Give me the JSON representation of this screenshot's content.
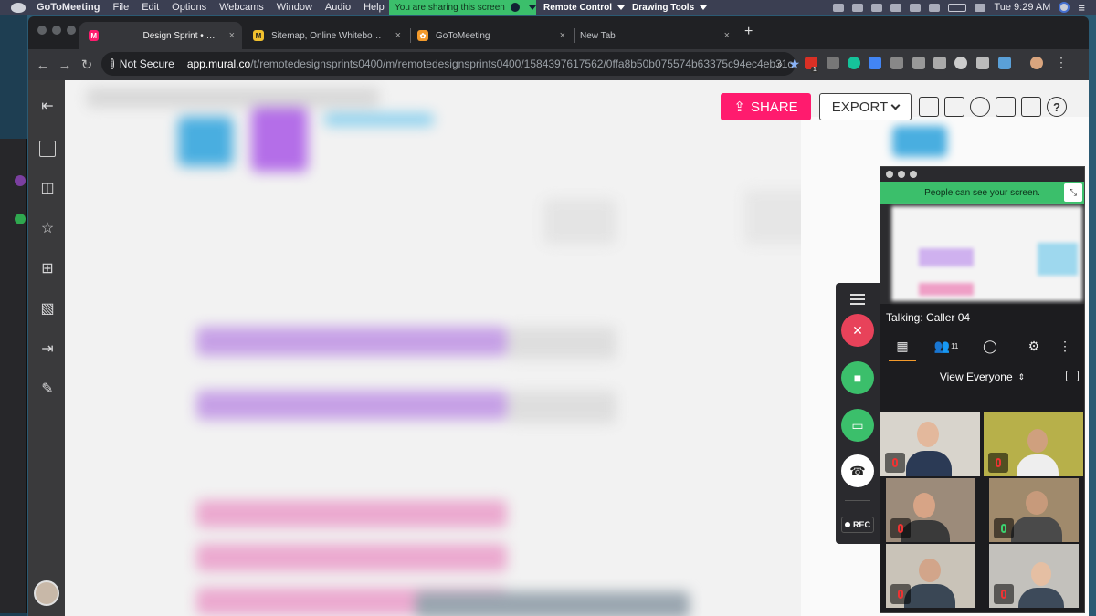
{
  "menubar": {
    "app": "GoToMeeting",
    "items": [
      "File",
      "Edit",
      "Options",
      "Webcams",
      "Window",
      "Audio",
      "Help"
    ],
    "sharing_banner": "You are sharing this screen",
    "remote_control": "Remote Control",
    "drawing_tools": "Drawing Tools",
    "clock": "Tue 9:29 AM"
  },
  "browser": {
    "tabs": [
      {
        "title": "Design Sprint • Remote",
        "favicon": "M",
        "color": "#ff1b6e",
        "active": true
      },
      {
        "title": "Sitemap, Online Whiteboard for Visual Collaboration",
        "favicon": "M",
        "color": "#f2c12e",
        "active": false
      },
      {
        "title": "GoToMeeting",
        "favicon": "✿",
        "color": "#f39a2b",
        "active": false
      },
      {
        "title": "New Tab",
        "favicon": "",
        "color": "",
        "active": false
      }
    ],
    "security": "Not Secure",
    "url_host": "app.mural.co",
    "url_path": "/t/remotedesignsprints0400/m/remotedesignsprints0400/1584397617562/0ffa8b50b075574b63375c94ec4eb31c...",
    "badge_count": "1"
  },
  "mural": {
    "share_label": "SHARE",
    "export_label": "EXPORT",
    "help_label": "?"
  },
  "gotomeeting": {
    "banner": "People can see your screen.",
    "talking": "Talking: Caller 04",
    "attendee_count": "11",
    "view_label": "View Everyone",
    "rec_label": "REC",
    "tiles": [
      {
        "mic": "muted"
      },
      {
        "mic": "muted"
      },
      {
        "mic": "muted"
      },
      {
        "mic": "active"
      },
      {
        "mic": "muted"
      },
      {
        "mic": "muted"
      }
    ]
  },
  "colors": {
    "share_pink": "#ff1b6e",
    "gtm_green": "#3bbf6b",
    "mic_red": "#e8425a",
    "accent_orange": "#f39a2b"
  }
}
